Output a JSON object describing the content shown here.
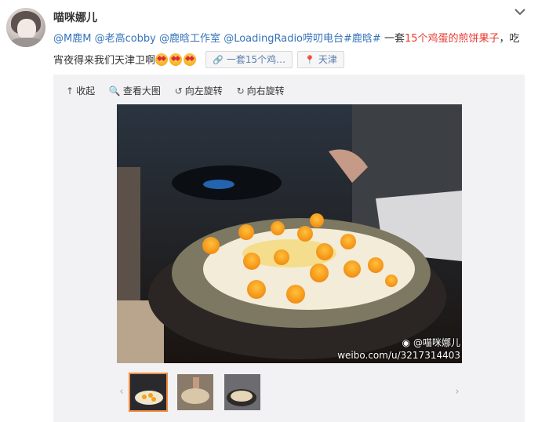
{
  "post": {
    "username": "喵咪娜儿",
    "mentions": [
      "@M鹿M",
      "@老高cobby",
      "@鹿晗工作室",
      "@LoadingRadio唠叨电台"
    ],
    "topic": "#鹿晗#",
    "text_before_highlight": "一套",
    "highlight_text": "15个鸡蛋的煎饼果子",
    "text_after": "，吃宵夜得来我们天津卫啊",
    "link_chip": "一套15个鸡…",
    "location_chip": "天津"
  },
  "toolbar": {
    "collapse": "收起",
    "view_large": "查看大图",
    "rotate_left": "向左旋转",
    "rotate_right": "向右旋转"
  },
  "photo": {
    "watermark_user": "@喵咪娜儿",
    "watermark_url": "weibo.com/u/3217314403",
    "thumbnail_count": 3,
    "active_thumbnail": 1
  },
  "icons": [
    "chevron-down-icon",
    "link-icon",
    "location-pin-icon",
    "collapse-arrow-icon",
    "magnifier-icon",
    "rotate-left-icon",
    "rotate-right-icon",
    "weibo-logo-icon",
    "chevron-left-icon",
    "chevron-right-icon"
  ],
  "colors": {
    "link": "#3573b9",
    "highlight": "#e8382f",
    "active_thumb": "#f08a3c",
    "panel": "#f2f2f5"
  }
}
